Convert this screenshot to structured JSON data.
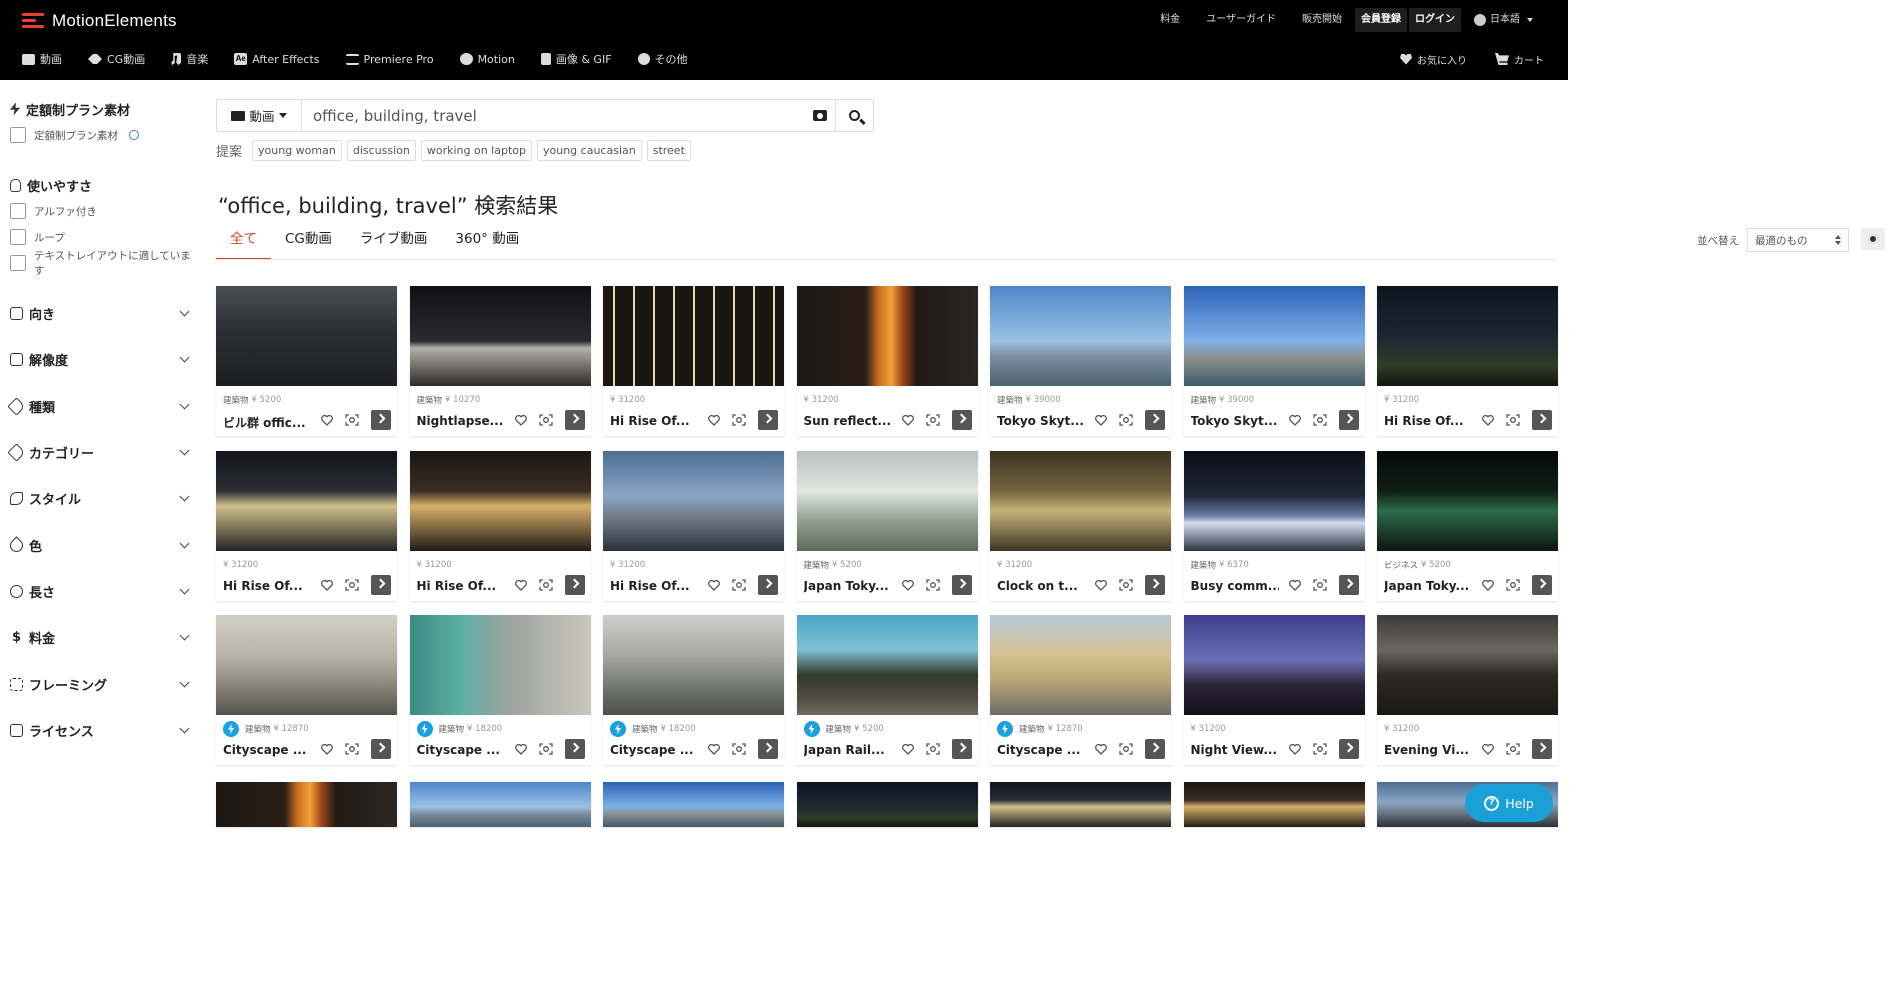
{
  "header": {
    "logo_text": "MotionElements",
    "links": [
      "料金",
      "ユーザーガイド",
      "販売開始"
    ],
    "signup": "会員登録",
    "login": "ログイン",
    "language": "日本語"
  },
  "catnav": {
    "items": [
      "動画",
      "CG動画",
      "音楽",
      "After Effects",
      "Premiere Pro",
      "Motion",
      "画像 & GIF",
      "その他"
    ],
    "favorites": "お気に入り",
    "cart": "カート"
  },
  "sidebar": {
    "plan": {
      "title": "定額制プラン素材",
      "check": "定額制プラン素材"
    },
    "usability": {
      "title": "使いやすさ",
      "checks": [
        "アルファ付き",
        "ループ",
        "テキストレイアウトに適しています"
      ]
    },
    "filters": [
      "向き",
      "解像度",
      "種類",
      "カテゴリー",
      "スタイル",
      "色",
      "長さ",
      "料金",
      "フレーミング",
      "ライセンス"
    ]
  },
  "search": {
    "type_label": "動画",
    "query": "office, building, travel"
  },
  "suggest": {
    "label": "提案",
    "chips": [
      "young woman",
      "discussion",
      "working on laptop",
      "young caucasian",
      "street"
    ]
  },
  "results": {
    "title": "“office, building, travel” 検索結果",
    "tabs": [
      "全て",
      "CG動画",
      "ライブ動画",
      "360° 動画"
    ],
    "sort_label": "並べ替え",
    "sort_value": "最適のもの"
  },
  "cards": [
    {
      "cat": "建築物",
      "price": "¥ 5200",
      "title": "ビル群 offic...",
      "bolt": false
    },
    {
      "cat": "建築物",
      "price": "¥ 10270",
      "title": "Nightlapse...",
      "bolt": false
    },
    {
      "cat": "",
      "price": "¥ 31200",
      "title": "Hi Rise Of...",
      "bolt": false
    },
    {
      "cat": "",
      "price": "¥ 31200",
      "title": "Sun reflect...",
      "bolt": false
    },
    {
      "cat": "建築物",
      "price": "¥ 39000",
      "title": "Tokyo Skyt...",
      "bolt": false
    },
    {
      "cat": "建築物",
      "price": "¥ 39000",
      "title": "Tokyo Skyt...",
      "bolt": false
    },
    {
      "cat": "",
      "price": "¥ 31200",
      "title": "Hi Rise Of...",
      "bolt": false
    },
    {
      "cat": "",
      "price": "¥ 31200",
      "title": "Hi Rise Of...",
      "bolt": false
    },
    {
      "cat": "",
      "price": "¥ 31200",
      "title": "Hi Rise Of...",
      "bolt": false
    },
    {
      "cat": "",
      "price": "¥ 31200",
      "title": "Hi Rise Of...",
      "bolt": false
    },
    {
      "cat": "建築物",
      "price": "¥ 5200",
      "title": "Japan Toky...",
      "bolt": false
    },
    {
      "cat": "",
      "price": "¥ 31200",
      "title": "Clock on t...",
      "bolt": false
    },
    {
      "cat": "建築物",
      "price": "¥ 6370",
      "title": "Busy comm...",
      "bolt": false
    },
    {
      "cat": "ビジネス",
      "price": "¥ 5200",
      "title": "Japan Toky...",
      "bolt": false
    },
    {
      "cat": "建築物",
      "price": "¥ 12870",
      "title": "Cityscape ...",
      "bolt": true
    },
    {
      "cat": "建築物",
      "price": "¥ 18200",
      "title": "Cityscape ...",
      "bolt": true
    },
    {
      "cat": "建築物",
      "price": "¥ 18200",
      "title": "Cityscape ...",
      "bolt": true
    },
    {
      "cat": "建築物",
      "price": "¥ 5200",
      "title": "Japan Rail...",
      "bolt": true
    },
    {
      "cat": "建築物",
      "price": "¥ 12870",
      "title": "Cityscape ...",
      "bolt": true
    },
    {
      "cat": "",
      "price": "¥ 31200",
      "title": "Night View...",
      "bolt": false
    },
    {
      "cat": "",
      "price": "¥ 31200",
      "title": "Evening Vi...",
      "bolt": false
    }
  ],
  "help": {
    "label": "Help"
  },
  "colors": {
    "accent": "#d04a2a",
    "logo": "#e8412e",
    "help": "#1a9fd6",
    "bolt": "#1a9fe0"
  }
}
